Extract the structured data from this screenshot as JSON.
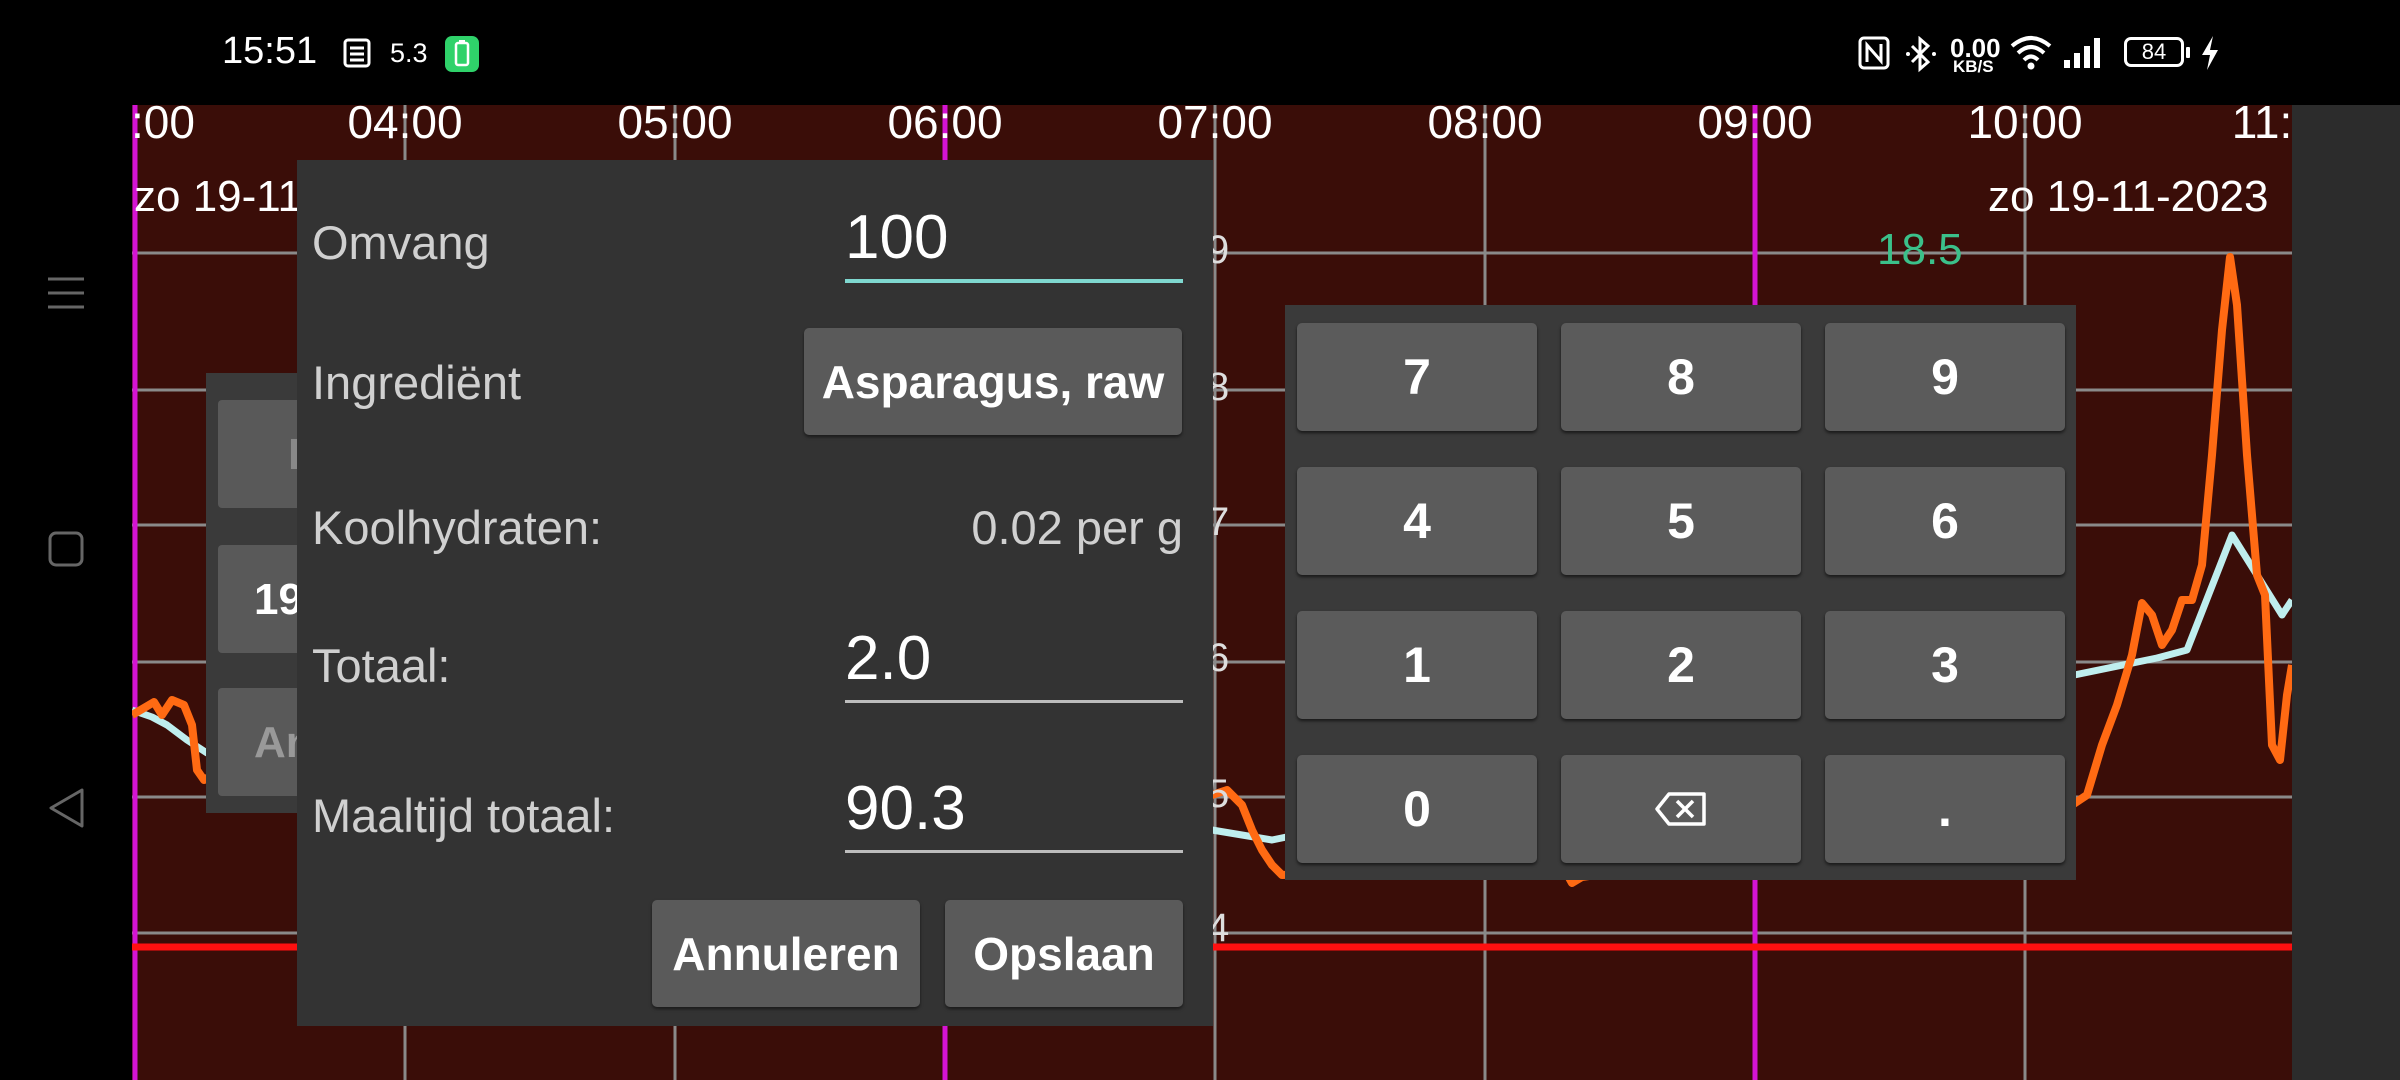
{
  "status_bar": {
    "time": "15:51",
    "net_speed_value": "0.00",
    "net_speed_unit": "KB/S",
    "battery_level": "84",
    "notification_text": "5.3",
    "icons": [
      "notes-icon",
      "battery-saver-icon",
      "nfc-icon",
      "bluetooth-icon",
      "wifi-icon",
      "signal-icon",
      "battery-icon",
      "charging-icon"
    ]
  },
  "chart": {
    "time_ticks": [
      ":00",
      "04:00",
      "05:00",
      "06:00",
      "07:00",
      "08:00",
      "09:00",
      "10:00",
      "11:"
    ],
    "date_left": "zo 19-11",
    "date_right": "zo 19-11-2023",
    "value_label": "18.5",
    "y_ticks": [
      "9",
      "8",
      "7",
      "6",
      "5",
      "4"
    ],
    "colors": {
      "background": "#3a0d08",
      "orange_line": "#ff6a13",
      "blue_line": "#bfeeee",
      "low_line": "#ff1010",
      "magenta_grid": "#d414d4"
    }
  },
  "background_dialog": {
    "visible_texts": [
      "I",
      "19",
      "An"
    ]
  },
  "dialog": {
    "size_label": "Omvang",
    "size_value": "100",
    "ingredient_label": "Ingrediënt",
    "ingredient_button": "Asparagus, raw",
    "carbs_label": "Koolhydraten:",
    "carbs_value": "0.02 per g",
    "total_label": "Totaal:",
    "total_value": "2.0",
    "meal_total_label": "Maaltijd totaal:",
    "meal_total_value": "90.3",
    "cancel_button": "Annuleren",
    "save_button": "Opslaan",
    "accent_color": "#7fd8d0"
  },
  "keypad": {
    "keys": [
      "7",
      "8",
      "9",
      "4",
      "5",
      "6",
      "1",
      "2",
      "3",
      "0",
      "⌫",
      "."
    ]
  }
}
